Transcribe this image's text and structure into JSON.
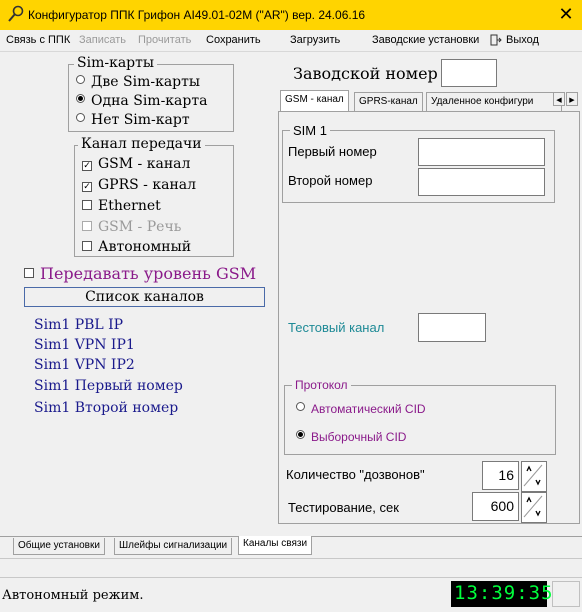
{
  "window": {
    "title": "Конфигуратор ППК Грифон AI49.01-02M (\"AR\") вер. 24.06.16",
    "close_glyph": "✕",
    "accent": "#ffd400"
  },
  "menu": {
    "items": [
      "Связь с ППК",
      "Записать",
      "Прочитать",
      "Сохранить",
      "Загрузить",
      "Заводские установки",
      "Выход"
    ],
    "disabled": [
      "Записать",
      "Прочитать"
    ]
  },
  "sim_cards": {
    "legend": "Sim-карты",
    "options": [
      "Две Sim-карты",
      "Одна Sim-карта",
      "Нет Sim-карт"
    ],
    "selected": "Одна Sim-карта"
  },
  "transfer_channel": {
    "legend": "Канал передачи",
    "options": [
      {
        "label": "GSM - канал",
        "checked": true,
        "enabled": true
      },
      {
        "label": "GPRS - канал",
        "checked": true,
        "enabled": true
      },
      {
        "label": "Ethernet",
        "checked": false,
        "enabled": true
      },
      {
        "label": "GSM - Речь",
        "checked": false,
        "enabled": false
      },
      {
        "label": "Автономный",
        "checked": false,
        "enabled": true
      }
    ]
  },
  "gsm_level": {
    "label": "Передавать уровень GSM",
    "checked": false
  },
  "channel_list": {
    "button_label": "Список каналов",
    "items": [
      "Sim1 PBL IP",
      "Sim1 VPN IP1",
      "Sim1 VPN IP2",
      "Sim1 Первый номер",
      "Sim1 Второй номер"
    ]
  },
  "factory_number": {
    "label": "Заводской номер",
    "value": ""
  },
  "tabs": {
    "items": [
      "GSM - канал",
      "GPRS-канал",
      "Удаленное конфигури"
    ],
    "active": "GSM - канал",
    "scroll_left": "◀",
    "scroll_right": "▶"
  },
  "sim1": {
    "legend": "SIM 1",
    "first_number_label": "Первый номер",
    "first_number_value": "",
    "second_number_label": "Второй номер",
    "second_number_value": ""
  },
  "test_channel": {
    "label": "Тестовый канал",
    "value": ""
  },
  "protocol": {
    "legend": "Протокол",
    "options": [
      "Автоматический CID",
      "Выборочный CID"
    ],
    "selected": "Выборочный CID"
  },
  "dial_count": {
    "label": "Количество \"дозвонов\"",
    "value": "16"
  },
  "testing": {
    "label": "Тестирование,  сек",
    "value": "600"
  },
  "bottom_tabs": {
    "items": [
      "Общие установки",
      "Шлейфы сигнализации",
      "Каналы связи"
    ],
    "active": "Каналы связи"
  },
  "status": {
    "text": "Автономный режим.",
    "clock": "13:39:35",
    "clock_color": "#00ff3c"
  }
}
